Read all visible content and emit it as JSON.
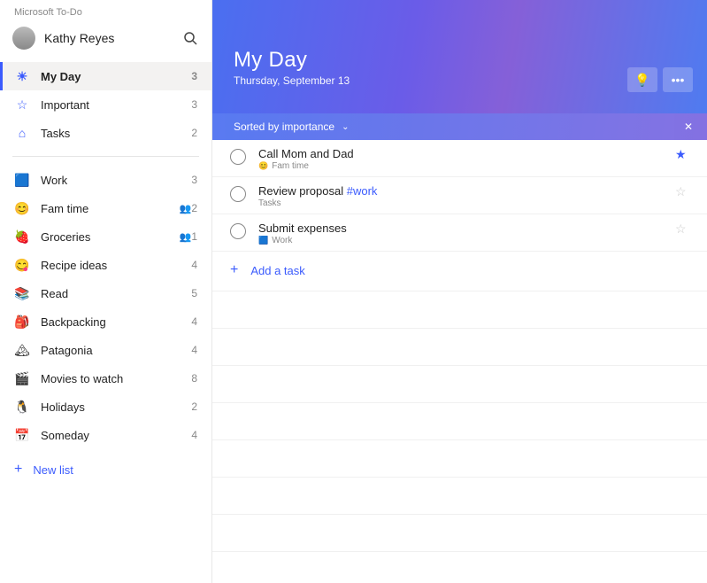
{
  "app_title": "Microsoft To-Do",
  "user": {
    "name": "Kathy Reyes"
  },
  "smart_lists": [
    {
      "id": "myday",
      "label": "My Day",
      "count": 3,
      "icon": "☀",
      "iconColor": "#3b5bfd"
    },
    {
      "id": "important",
      "label": "Important",
      "count": 3,
      "icon": "☆",
      "iconColor": "#3b5bfd"
    },
    {
      "id": "tasks",
      "label": "Tasks",
      "count": 2,
      "icon": "⌂",
      "iconColor": "#3b5bfd"
    }
  ],
  "custom_lists": [
    {
      "id": "work",
      "label": "Work",
      "count": 3,
      "icon": "🟦",
      "shared": false
    },
    {
      "id": "fam",
      "label": "Fam time",
      "count": 2,
      "icon": "😊",
      "shared": true
    },
    {
      "id": "groceries",
      "label": "Groceries",
      "count": 1,
      "icon": "🍓",
      "shared": true
    },
    {
      "id": "recipe",
      "label": "Recipe ideas",
      "count": 4,
      "icon": "😋",
      "shared": false
    },
    {
      "id": "read",
      "label": "Read",
      "count": 5,
      "icon": "📚",
      "shared": false
    },
    {
      "id": "backpacking",
      "label": "Backpacking",
      "count": 4,
      "icon": "🎒",
      "shared": false
    },
    {
      "id": "patagonia",
      "label": "Patagonia",
      "count": 4,
      "icon": "🏔",
      "shared": false
    },
    {
      "id": "movies",
      "label": "Movies to watch",
      "count": 8,
      "icon": "🎬",
      "shared": false
    },
    {
      "id": "holidays",
      "label": "Holidays",
      "count": 2,
      "icon": "🐧",
      "shared": false
    },
    {
      "id": "someday",
      "label": "Someday",
      "count": 4,
      "icon": "📅",
      "shared": false
    }
  ],
  "new_list_label": "New list",
  "header": {
    "title": "My Day",
    "date": "Thursday, September 13"
  },
  "sort_bar": {
    "text": "Sorted by importance"
  },
  "tasks": [
    {
      "title": "Call Mom and Dad",
      "tag": "",
      "list": "Fam time",
      "listIcon": "😊",
      "starred": true
    },
    {
      "title": "Review proposal",
      "tag": "#work",
      "list": "Tasks",
      "listIcon": "",
      "starred": false
    },
    {
      "title": "Submit expenses",
      "tag": "",
      "list": "Work",
      "listIcon": "🟦",
      "starred": false
    }
  ],
  "add_task_label": "Add a task"
}
